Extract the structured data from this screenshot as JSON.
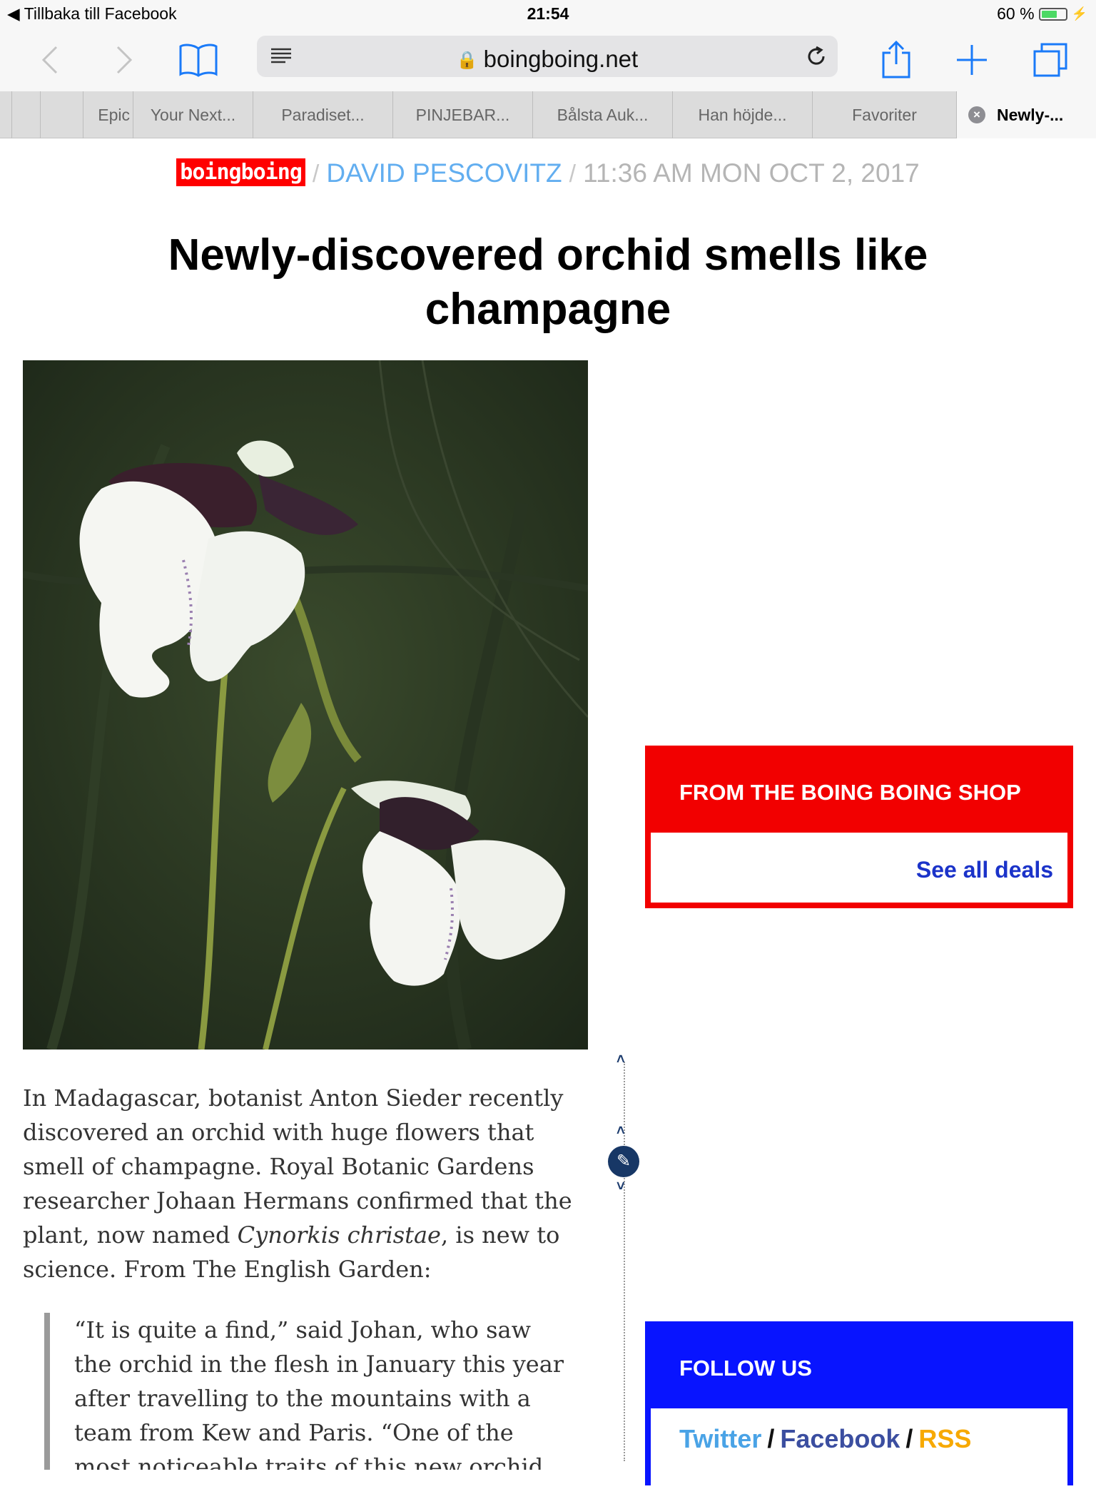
{
  "status_bar": {
    "back_label": "Tillbaka till Facebook",
    "time": "21:54",
    "battery": "60 %",
    "battery_level": 0.6
  },
  "browser": {
    "url": "boingboing.net",
    "tabs": [
      {
        "label": ""
      },
      {
        "label": ""
      },
      {
        "label": "Epic"
      },
      {
        "label": "Your Next..."
      },
      {
        "label": "Paradiset..."
      },
      {
        "label": "PINJEBAR..."
      },
      {
        "label": "Bålsta Auk..."
      },
      {
        "label": "Han höjde..."
      },
      {
        "label": "Favoriter"
      },
      {
        "label": "Newly-..."
      }
    ]
  },
  "byline": {
    "site": "boingboing",
    "author": "DAVID PESCOVITZ",
    "date": "11:36 AM MON OCT 2, 2017"
  },
  "headline": "Newly-discovered orchid smells like champagne",
  "article": {
    "p1_part1": "In Madagascar, botanist Anton Sieder recently discovered an orchid with huge flowers that smell of champagne. Royal Botanic Gardens researcher Johaan Hermans confirmed that the plant, now named ",
    "p1_italic": "Cynorkis christae",
    "p1_part2": ", is new to science. From The English Garden:",
    "quote": "“It is quite a find,” said Johan, who saw the orchid in the flesh in January this year after travelling to the mountains with a team from Kew and Paris. “One of the most noticeable traits of this new orchid"
  },
  "shop": {
    "title": "FROM THE BOING BOING SHOP",
    "link": "See all deals"
  },
  "follow": {
    "title": "FOLLOW US",
    "twitter": "Twitter",
    "facebook": "Facebook",
    "rss": "RSS"
  }
}
